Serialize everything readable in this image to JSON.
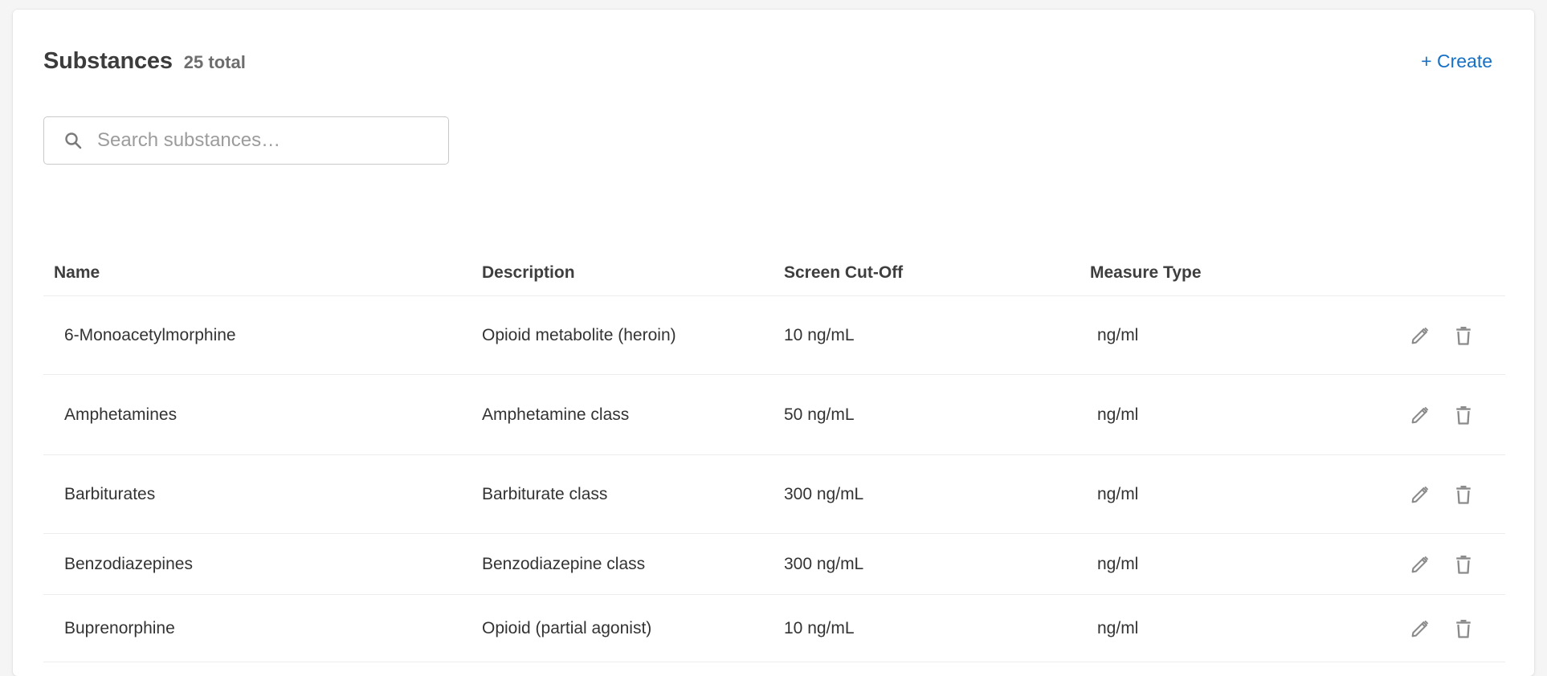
{
  "header": {
    "title": "Substances",
    "count": "25 total",
    "create_label": "+ Create"
  },
  "search": {
    "placeholder": "Search substances…",
    "value": ""
  },
  "table": {
    "columns": {
      "name": "Name",
      "description": "Description",
      "cutoff": "Screen Cut-Off",
      "measure": "Measure Type"
    },
    "rows": [
      {
        "name": "6-Monoacetylmorphine",
        "description": "Opioid metabolite (heroin)",
        "cutoff": "10 ng/mL",
        "measure": "ng/ml"
      },
      {
        "name": "Amphetamines",
        "description": "Amphetamine class",
        "cutoff": "50 ng/mL",
        "measure": "ng/ml"
      },
      {
        "name": "Barbiturates",
        "description": "Barbiturate class",
        "cutoff": "300 ng/mL",
        "measure": "ng/ml"
      },
      {
        "name": "Benzodiazepines",
        "description": "Benzodiazepine class",
        "cutoff": "300 ng/mL",
        "measure": "ng/ml"
      },
      {
        "name": "Buprenorphine",
        "description": "Opioid (partial agonist)",
        "cutoff": "10 ng/mL",
        "measure": "ng/ml"
      }
    ],
    "row_actions": [
      "edit-icon",
      "delete-icon"
    ]
  },
  "colors": {
    "accent": "#1570c6",
    "icon": "#8a8a8a"
  }
}
